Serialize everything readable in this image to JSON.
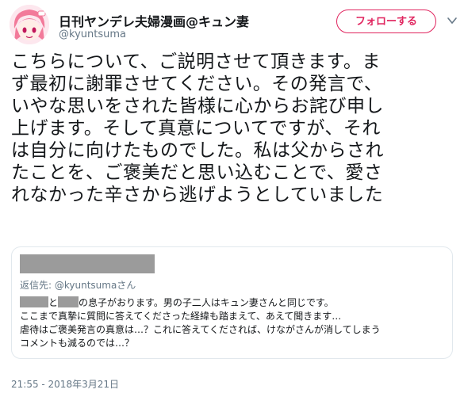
{
  "author": {
    "display_name": "日刊ヤンデレ夫婦漫画@キュン妻",
    "handle": "@kyuntsuma",
    "avatar_icon": "anime-girl-avatar-icon"
  },
  "actions": {
    "follow_label": "フォローする",
    "menu_icon": "chevron-down-icon"
  },
  "tweet": {
    "text": "こちらについて、ご説明させて頂きます。ま\nず最初に謝罪させてください。その発言で、\nいやな思いをされた皆様に心からお詫び申し\n上げます。そして真意についてですが、それ\nは自分に向けたものでした。私は父からされ\nたことを、ご褒美だと思い込むことで、愛さ\nれなかった辛さから逃げようとしていました"
  },
  "quoted": {
    "reply_to": "返信先: @kyuntsumaさん",
    "line1_part1": "と",
    "line1_part2": "の息子がおります。男の子二人はキュン妻さんと同じです。",
    "line2": "ここまで真摯に質問に答えてくださった経緯も踏まえて、あえて聞きます…",
    "line3": "虐待はご褒美発言の真意は…？これに答えてくだされば、けながさんが消してしまう",
    "line4": "コメントも減るのでは…？"
  },
  "timestamp": "21:55 - 2018年3月21日",
  "colors": {
    "accent": "#e0245e",
    "secondary_text": "#657786",
    "redaction": "#9b9b9b"
  }
}
